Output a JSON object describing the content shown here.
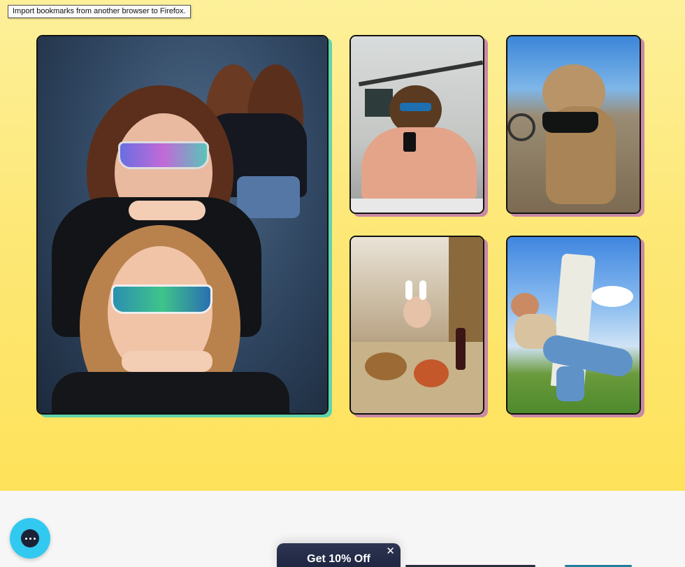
{
  "tooltip": {
    "text": "Import bookmarks from another browser to Firefox."
  },
  "gallery": {
    "photos": [
      {
        "alt": "two-people-wearing-shield-sunglasses"
      },
      {
        "alt": "person-holding-sword-selfie"
      },
      {
        "alt": "dog-wearing-sunglasses"
      },
      {
        "alt": "person-with-bunny-ears-at-feast"
      },
      {
        "alt": "person-posing-leaning-tower"
      }
    ]
  },
  "promo": {
    "label": "Get 10% Off",
    "close": "✕"
  },
  "chat": {
    "icon": "chat-bubble-icon"
  },
  "colors": {
    "hero_top": "#fdf09a",
    "hero_bottom": "#fee25a",
    "accent_green": "#5fd4ae",
    "accent_pink": "#c98aa4",
    "chat_blue": "#32c9f0",
    "promo_navy": "#1d2440"
  }
}
